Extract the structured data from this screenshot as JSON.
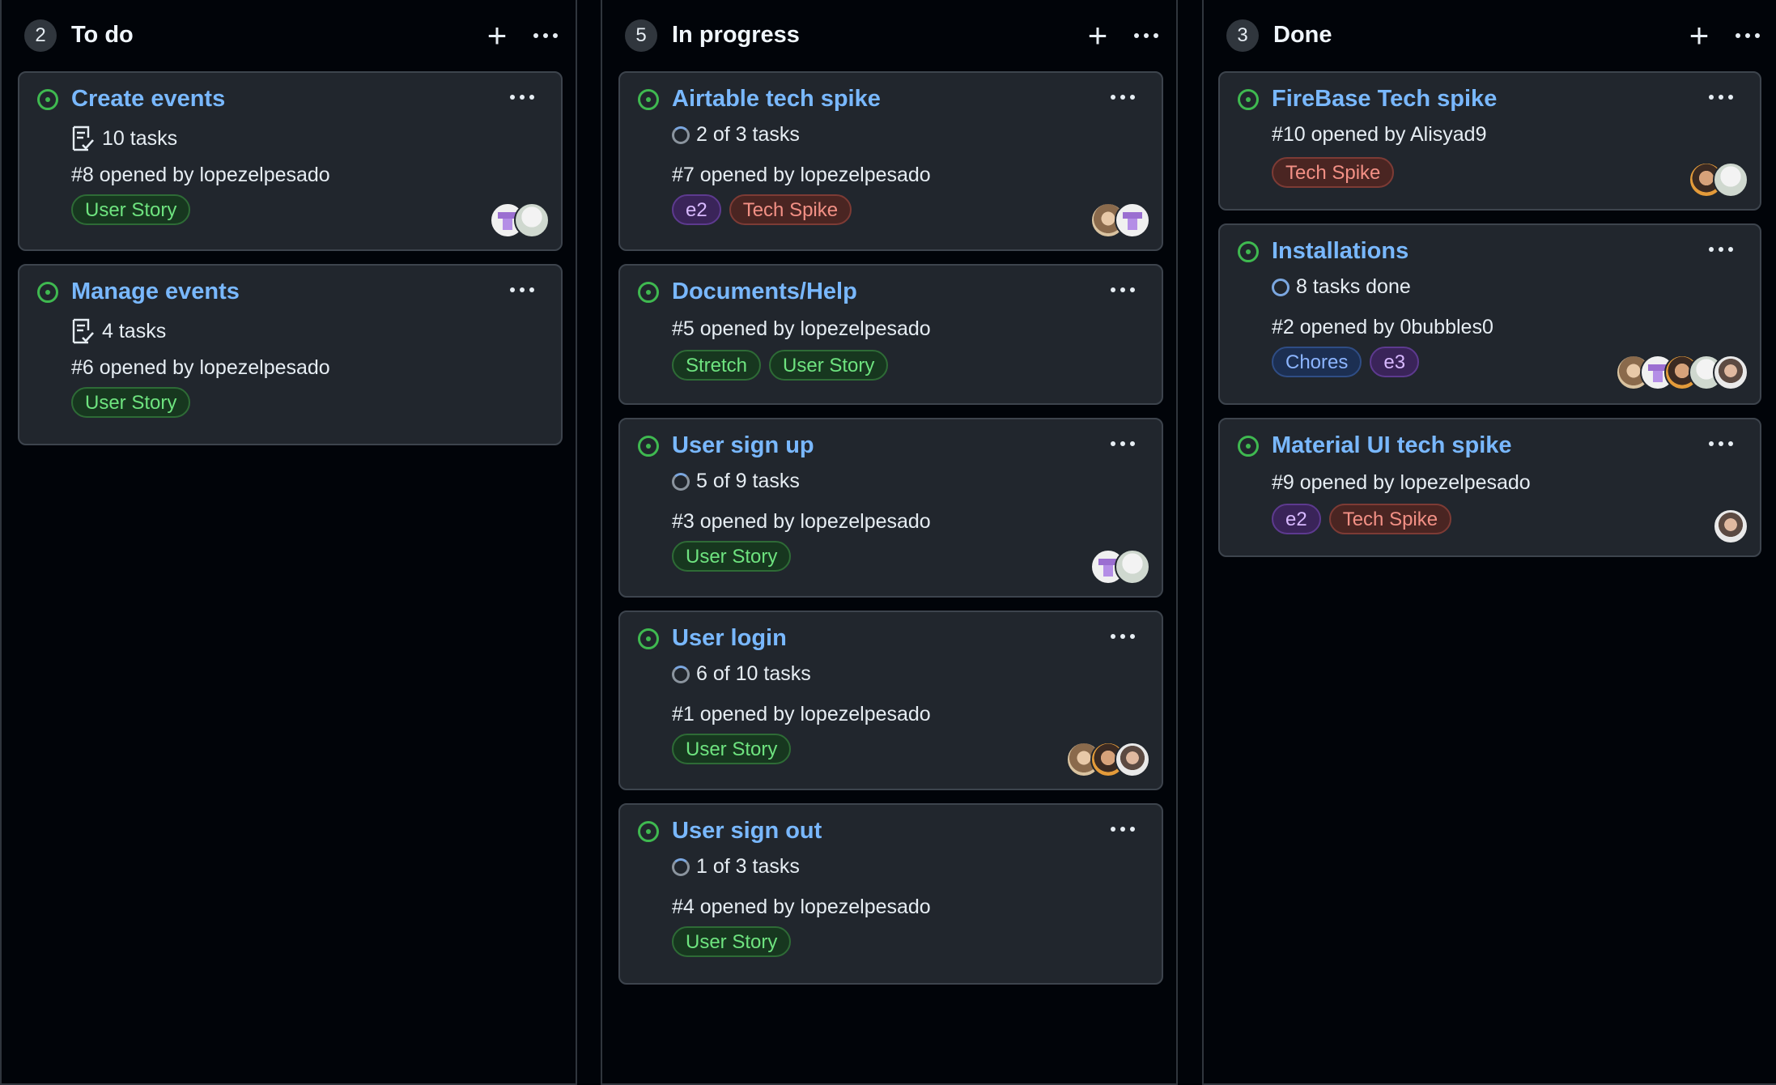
{
  "columns": [
    {
      "count": "2",
      "title": "To do",
      "cards": [
        {
          "title": "Create events",
          "tasks": "10 tasks",
          "opened": "#8 opened by lopezelpesado",
          "labels": [
            "User Story"
          ]
        },
        {
          "title": "Manage events",
          "tasks": "4 tasks",
          "opened": "#6 opened by lopezelpesado",
          "labels": [
            "User Story"
          ]
        }
      ]
    },
    {
      "count": "5",
      "title": "In progress",
      "cards": [
        {
          "title": "Airtable tech spike",
          "tasks": "2 of 3 tasks",
          "opened": "#7 opened by lopezelpesado",
          "labels": [
            "e2",
            "Tech Spike"
          ]
        },
        {
          "title": "Documents/Help",
          "opened": "#5 opened by lopezelpesado",
          "labels": [
            "Stretch",
            "User Story"
          ]
        },
        {
          "title": "User sign up",
          "tasks": "5 of 9 tasks",
          "opened": "#3 opened by lopezelpesado",
          "labels": [
            "User Story"
          ]
        },
        {
          "title": "User login",
          "tasks": "6 of 10 tasks",
          "opened": "#1 opened by lopezelpesado",
          "labels": [
            "User Story"
          ]
        },
        {
          "title": "User sign out",
          "tasks": "1 of 3 tasks",
          "opened": "#4 opened by lopezelpesado",
          "labels": [
            "User Story"
          ]
        }
      ]
    },
    {
      "count": "3",
      "title": "Done",
      "cards": [
        {
          "title": "FireBase Tech spike",
          "opened": "#10 opened by Alisyad9",
          "labels": [
            "Tech Spike"
          ]
        },
        {
          "title": "Installations",
          "tasks": "8 tasks done",
          "opened": "#2 opened by 0bubbles0",
          "labels": [
            "Chores",
            "e3"
          ]
        },
        {
          "title": "Material UI tech spike",
          "opened": "#9 opened by lopezelpesado",
          "labels": [
            "e2",
            "Tech Spike"
          ]
        }
      ]
    }
  ],
  "icons": {
    "add": "plus-icon",
    "more": "kebab-horizontal-icon",
    "status": "issue-opened-icon",
    "tasklist": "tasklist-icon",
    "progress": "progress-ring-icon"
  },
  "colors": {
    "background": "#010409",
    "card": "#21262d",
    "title_link": "#79b8ff",
    "open_status": "#3fb950"
  }
}
